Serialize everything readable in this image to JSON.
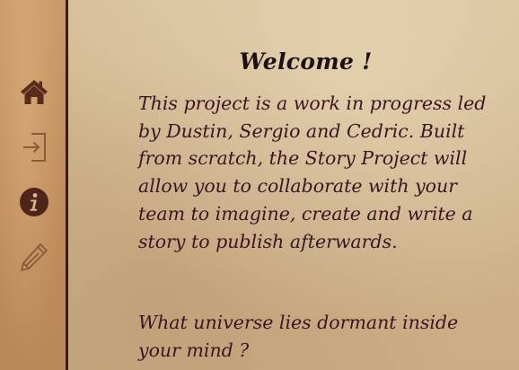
{
  "sidebar": {
    "items": [
      {
        "icon": "home-icon",
        "color": "#5a2a1c"
      },
      {
        "icon": "login-icon",
        "color": "#8a5a3c"
      },
      {
        "icon": "info-icon",
        "color": "#4f2519"
      },
      {
        "icon": "pencil-icon",
        "color": "#8a5a3c"
      }
    ]
  },
  "main": {
    "title": "Welcome !",
    "intro": "This project is a work in progress led by Dustin, Sergio and Cedric. Built from scratch, the Story Project will allow you to collaborate with your team to imagine, create and write a story to publish afterwards.",
    "question": "What universe lies dormant inside your mind ?"
  },
  "colors": {
    "sidebar_border": "#3b1c14",
    "text": "#3d1424",
    "title": "#1d1014"
  }
}
